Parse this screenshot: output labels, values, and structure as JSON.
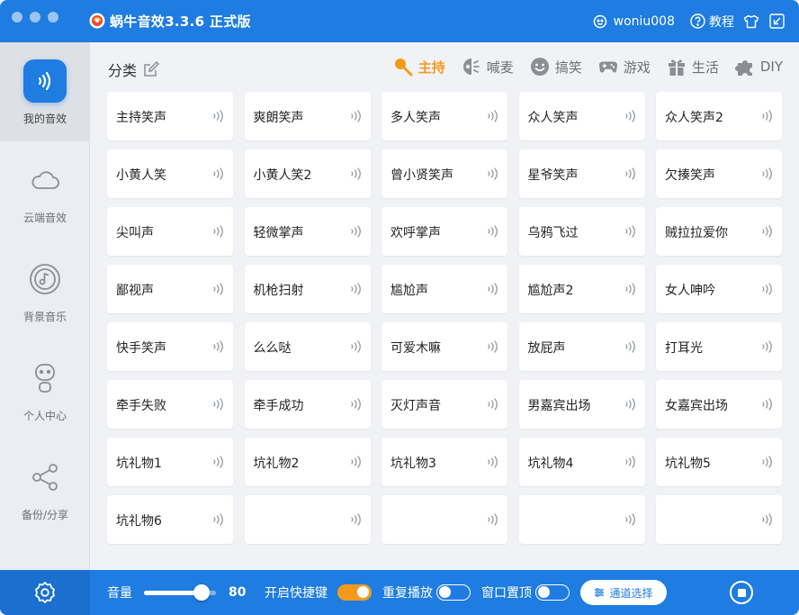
{
  "window": {
    "title": "蜗牛音效3.3.6 正式版"
  },
  "user": {
    "username": "woniu008",
    "help_label": "教程"
  },
  "sidebar": {
    "items": [
      {
        "label": "我的音效",
        "icon": "sound-wave-icon"
      },
      {
        "label": "云端音效",
        "icon": "cloud-icon"
      },
      {
        "label": "背景音乐",
        "icon": "music-disc-icon"
      },
      {
        "label": "个人中心",
        "icon": "person-icon"
      },
      {
        "label": "备份/分享",
        "icon": "share-icon"
      }
    ]
  },
  "main": {
    "category_label": "分类",
    "tabs": [
      {
        "label": "主持",
        "icon": "microphone-icon",
        "active": true
      },
      {
        "label": "喊麦",
        "icon": "megaphone-icon"
      },
      {
        "label": "搞笑",
        "icon": "smile-icon"
      },
      {
        "label": "游戏",
        "icon": "gamepad-icon"
      },
      {
        "label": "生活",
        "icon": "gift-icon"
      },
      {
        "label": "DIY",
        "icon": "puzzle-icon"
      }
    ],
    "sounds": [
      "主持笑声",
      "爽朗笑声",
      "多人笑声",
      "众人笑声",
      "众人笑声2",
      "小黄人笑",
      "小黄人笑2",
      "曾小贤笑声",
      "星爷笑声",
      "欠揍笑声",
      "尖叫声",
      "轻微掌声",
      "欢呼掌声",
      "乌鸦飞过",
      "贼拉拉爱你",
      "鄙视声",
      "机枪扫射",
      "尴尬声",
      "尴尬声2",
      "女人呻吟",
      "快手笑声",
      "么么哒",
      "可爱木嘛",
      "放屁声",
      "打耳光",
      "牵手失败",
      "牵手成功",
      "灭灯声音",
      "男嘉宾出场",
      "女嘉宾出场",
      "坑礼物1",
      "坑礼物2",
      "坑礼物3",
      "坑礼物4",
      "坑礼物5",
      "坑礼物6",
      "",
      "",
      "",
      ""
    ]
  },
  "bottom": {
    "volume_label": "音量",
    "volume_value": "80",
    "volume_level": 0.8,
    "hotkey_label": "开启快捷键",
    "hotkey_on": true,
    "repeat_label": "重复播放",
    "repeat_on": false,
    "ontop_label": "窗口置顶",
    "ontop_on": false,
    "channel_label": "通道选择"
  },
  "colors": {
    "primary": "#1f7ce0",
    "accent": "#f39a1d"
  }
}
